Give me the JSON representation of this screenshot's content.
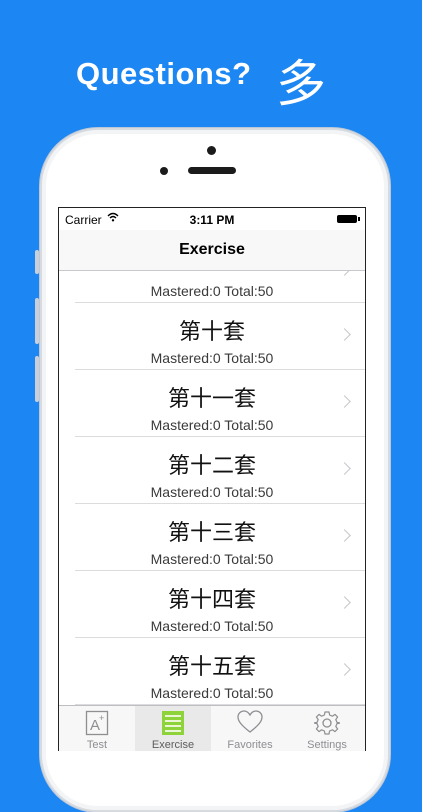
{
  "promo": {
    "headline": "Questions?",
    "character": "多"
  },
  "statusbar": {
    "carrier": "Carrier",
    "time": "3:11 PM"
  },
  "navbar": {
    "title": "Exercise"
  },
  "list": {
    "partial_row_subtitle": "Mastered:0 Total:50",
    "rows": [
      {
        "title": "第十套",
        "subtitle": "Mastered:0 Total:50"
      },
      {
        "title": "第十一套",
        "subtitle": "Mastered:0 Total:50"
      },
      {
        "title": "第十二套",
        "subtitle": "Mastered:0 Total:50"
      },
      {
        "title": "第十三套",
        "subtitle": "Mastered:0 Total:50"
      },
      {
        "title": "第十四套",
        "subtitle": "Mastered:0 Total:50"
      },
      {
        "title": "第十五套",
        "subtitle": "Mastered:0 Total:50"
      }
    ]
  },
  "tabbar": {
    "tabs": [
      {
        "label": "Test",
        "icon": "a-plus-icon"
      },
      {
        "label": "Exercise",
        "icon": "list-icon",
        "active": true
      },
      {
        "label": "Favorites",
        "icon": "heart-icon"
      },
      {
        "label": "Settings",
        "icon": "gear-icon"
      }
    ]
  },
  "colors": {
    "background": "#1c86f2",
    "active_tab_icon": "#8ed33a"
  }
}
